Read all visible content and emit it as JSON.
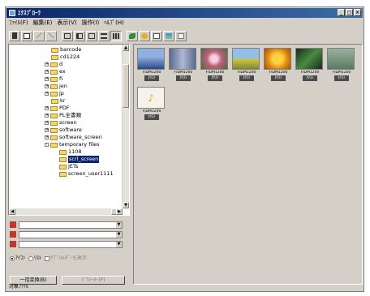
{
  "window": {
    "title": "ｴｸｽﾌﾟﾛｰﾗ"
  },
  "menu": [
    "ﾌｧｲﾙ(F)",
    "編集(E)",
    "表示(V)",
    "操作(I)",
    "ﾍﾙﾌﾟ(H)"
  ],
  "toolbar": {
    "tools": [
      "open-icon",
      "copy-icon",
      "pen-icon",
      "line-icon",
      "box-icon",
      "list-icon",
      "small-icon",
      "detail-icon",
      "large-icon",
      "leaf-icon",
      "wave-icon",
      "window-icon",
      "picture-icon",
      "frame-icon"
    ]
  },
  "tree": {
    "items": [
      {
        "label": "barcode",
        "exp": ""
      },
      {
        "label": "cd1224",
        "exp": ""
      },
      {
        "label": "d",
        "exp": "+"
      },
      {
        "label": "ex",
        "exp": "+"
      },
      {
        "label": "fi",
        "exp": "+"
      },
      {
        "label": "jen",
        "exp": "+"
      },
      {
        "label": "jp",
        "exp": "+"
      },
      {
        "label": "kr",
        "exp": ""
      },
      {
        "label": "PDF",
        "exp": "+"
      },
      {
        "label": "PL全書類",
        "exp": "+"
      },
      {
        "label": "screen",
        "exp": "+"
      },
      {
        "label": "software",
        "exp": "+"
      },
      {
        "label": "software_screen",
        "exp": "+"
      },
      {
        "label": "temporary files",
        "exp": "-"
      },
      {
        "label": "1108",
        "exp": ""
      },
      {
        "label": "scrl_screen",
        "exp": ""
      },
      {
        "label": "JETs",
        "exp": ""
      },
      {
        "label": "screen_user1111",
        "exp": ""
      }
    ]
  },
  "options": {
    "radio1": "ｱｲｺﾝ",
    "radio2": "ﾘｽﾄ",
    "check": "ｻﾌﾞﾌｫﾙﾀﾞｰも表示"
  },
  "buttons": {
    "left": "一括変換(B)",
    "right": "ﾊﾟﾗﾒｰﾀｰ(P)"
  },
  "thumbs": [
    {
      "name": "FIDM1200",
      "tag": "ﾈｸｽﾄ",
      "color": "#5a7cb8"
    },
    {
      "name": "FIDM1200",
      "tag": "ﾈｸｽﾄ",
      "color": "#7b8aa8"
    },
    {
      "name": "FIDM1200",
      "tag": "ﾈｸｽﾄ",
      "color": "#c88aa0"
    },
    {
      "name": "FIDM1200",
      "tag": "ﾈｸｽﾄ",
      "color": "#b9b84a"
    },
    {
      "name": "FIDM1200",
      "tag": "ﾈｸｽﾄ",
      "color": "#e0a21e"
    },
    {
      "name": "FIDM1200",
      "tag": "ﾈｸｽﾄ",
      "color": "#2f4a3a"
    },
    {
      "name": "FIDM1200",
      "tag": "ﾈｸｽﾄ",
      "color": "#6c8a78"
    },
    {
      "name": "FIDM1200",
      "tag": "ﾈｸｽﾄ",
      "color": "#f0f0e0"
    }
  ],
  "status": "対象ﾌｧｲﾙ"
}
